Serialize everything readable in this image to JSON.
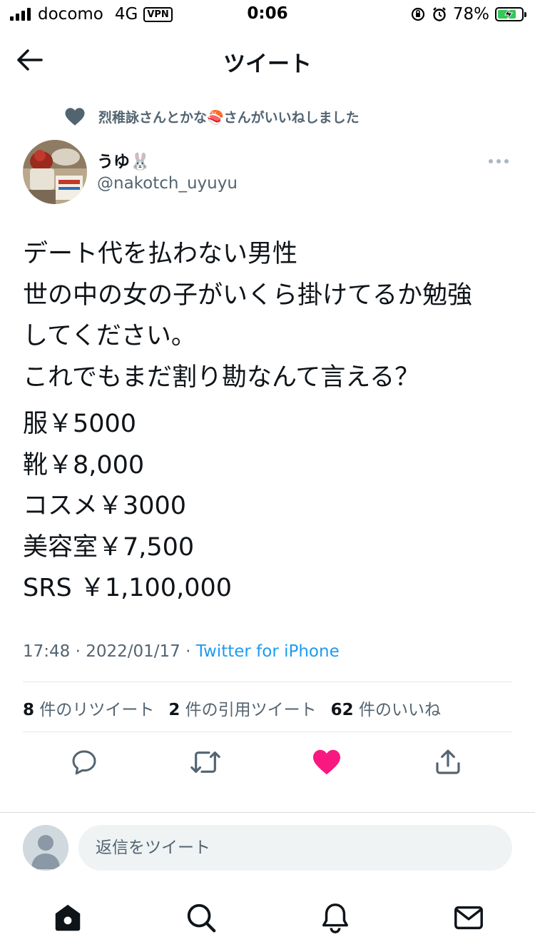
{
  "status_bar": {
    "carrier": "docomo",
    "network": "4G",
    "vpn": "VPN",
    "time": "0:06",
    "battery_percent": "78%",
    "battery_level": 0.78
  },
  "header": {
    "title": "ツイート"
  },
  "social_context": {
    "text": "烈稚詠さんとかな🍣さんがいいねしました"
  },
  "author": {
    "name": "うゆ🐰",
    "handle": "@nakotch_uyuyu"
  },
  "tweet": {
    "lines": [
      "デート代を払わない男性",
      "世の中の女の子がいくら掛けてるか勉強",
      "してください。",
      "これでもまだ割り勘なんて言える？"
    ],
    "price_lines": [
      "服￥5000",
      "靴￥8,000",
      "コスメ￥3000",
      "美容室￥7,500",
      "SRS ￥1,100,000"
    ]
  },
  "meta": {
    "time": "17:48",
    "date": "2022/01/17",
    "source": "Twitter for iPhone"
  },
  "stats": {
    "retweets_count": "8",
    "retweets_label": "件のリツイート",
    "quotes_count": "2",
    "quotes_label": "件の引用ツイート",
    "likes_count": "62",
    "likes_label": "件のいいね"
  },
  "colors": {
    "like_active": "#f91880",
    "link": "#1d9bf0",
    "secondary_text": "#536471",
    "battery_fill": "#34c759"
  },
  "reply": {
    "placeholder": "返信をツイート"
  },
  "tabbar": {
    "items": [
      "home-icon",
      "search-icon",
      "notifications-icon",
      "messages-icon"
    ]
  }
}
